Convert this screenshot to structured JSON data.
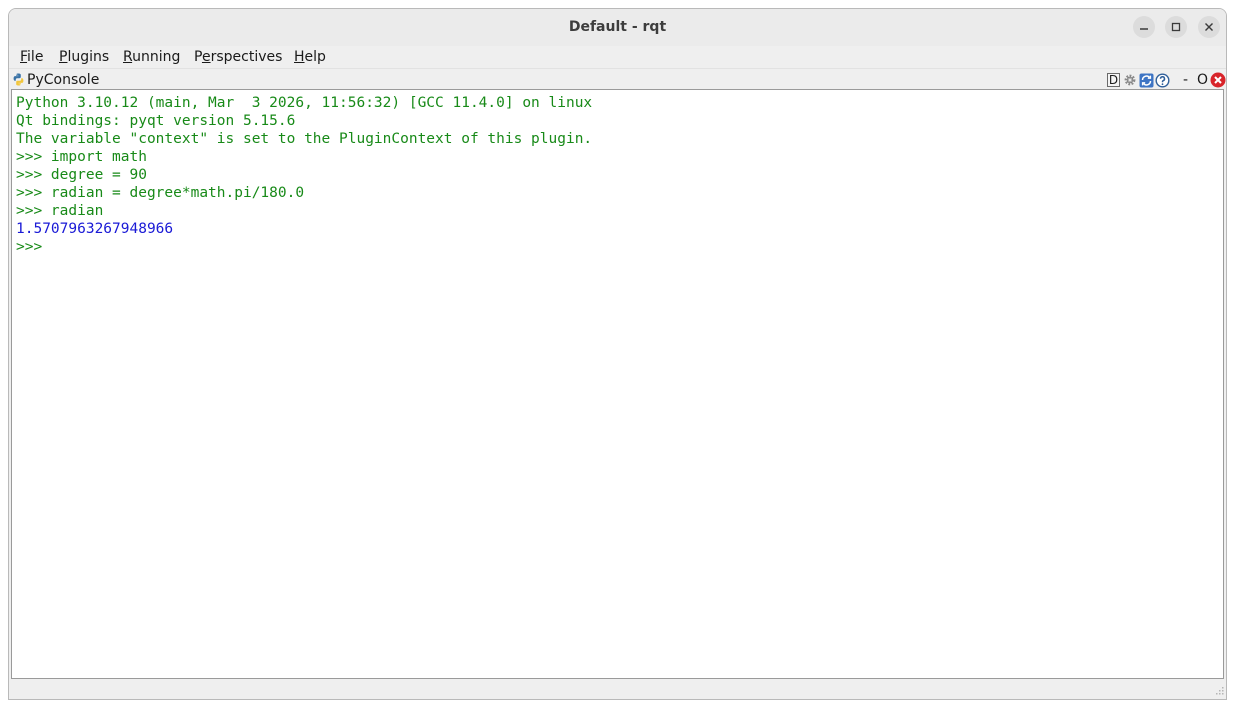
{
  "window": {
    "title": "Default - rqt",
    "controls": [
      "minimize-icon",
      "maximize-icon",
      "close-icon"
    ]
  },
  "menubar": {
    "items": [
      {
        "label": "File",
        "mnemonic_index": 0
      },
      {
        "label": "Plugins",
        "mnemonic_index": 0
      },
      {
        "label": "Running",
        "mnemonic_index": 0
      },
      {
        "label": "Perspectives",
        "mnemonic_index": 1
      },
      {
        "label": "Help",
        "mnemonic_index": 0
      }
    ]
  },
  "plugin": {
    "title": "PyConsole",
    "icon": "python-icon",
    "tools": {
      "dock_label": "D",
      "minimize_label": "-",
      "float_label": "O"
    }
  },
  "console": {
    "lines": [
      {
        "text": "Python 3.10.12 (main, Mar  3 2026, 11:56:32) [GCC 11.4.0] on linux",
        "color": "#188a18"
      },
      {
        "text": "Qt bindings: pyqt version 5.15.6",
        "color": "#188a18"
      },
      {
        "text": "The variable \"context\" is set to the PluginContext of this plugin.",
        "color": "#188a18"
      },
      {
        "text": ">>> import math",
        "color": "#188a18"
      },
      {
        "text": ">>> degree = 90",
        "color": "#188a18"
      },
      {
        "text": ">>> radian = degree*math.pi/180.0",
        "color": "#188a18"
      },
      {
        "text": ">>> radian",
        "color": "#188a18"
      },
      {
        "text": "1.5707963267948966",
        "color": "#1a1ad6"
      },
      {
        "text": ">>> ",
        "color": "#188a18"
      }
    ]
  }
}
